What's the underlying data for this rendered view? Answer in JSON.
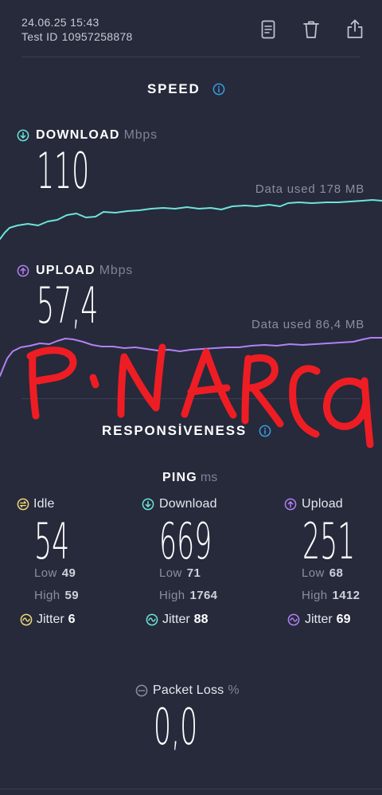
{
  "header": {
    "datetime": "24.06.25 15:43",
    "test_id_label": "Test ID",
    "test_id": "10957258878",
    "actions": [
      {
        "icon": "document-icon"
      },
      {
        "icon": "trash-icon"
      },
      {
        "icon": "share-icon"
      }
    ]
  },
  "speed": {
    "title": "SPEED",
    "info_icon": "info-icon",
    "download": {
      "icon": "download-arrow-icon",
      "label": "DOWNLOAD",
      "unit": "Mbps",
      "value": "110",
      "data_used_label": "Data used",
      "data_used": "178 MB"
    },
    "upload": {
      "icon": "upload-arrow-icon",
      "label": "UPLOAD",
      "unit": "Mbps",
      "value": "57,4",
      "data_used_label": "Data used",
      "data_used": "86,4 MB"
    }
  },
  "responsiveness": {
    "title": "RESPONSİVENESS",
    "info_icon": "info-icon",
    "ping_label": "PING",
    "ping_unit": "ms",
    "columns": [
      {
        "icon": "idle-icon",
        "label": "Idle",
        "value": "54",
        "low_label": "Low",
        "low": "49",
        "high_label": "High",
        "high": "59",
        "jitter_icon": "jitter-icon",
        "jitter_label": "Jitter",
        "jitter": "6"
      },
      {
        "icon": "download-arrow-icon",
        "label": "Download",
        "value": "669",
        "low_label": "Low",
        "low": "71",
        "high_label": "High",
        "high": "1764",
        "jitter_icon": "jitter-icon",
        "jitter_label": "Jitter",
        "jitter": "88"
      },
      {
        "icon": "upload-arrow-icon",
        "label": "Upload",
        "value": "251",
        "low_label": "Low",
        "low": "68",
        "high_label": "High",
        "high": "1412",
        "jitter_icon": "jitter-icon",
        "jitter_label": "Jitter",
        "jitter": "69"
      }
    ]
  },
  "packet_loss": {
    "icon": "packet-loss-icon",
    "label": "Packet Loss",
    "unit": "%",
    "value": "0,0"
  },
  "annotation": {
    "handwritten_text": "PINARCA"
  },
  "colors": {
    "background": "#262a3b",
    "download": "#6ee3d9",
    "upload": "#b281f2",
    "idle": "#f3d77a",
    "info": "#3b9ce0",
    "muted": "#8a8ea0",
    "annotation": "#ee1d24"
  }
}
